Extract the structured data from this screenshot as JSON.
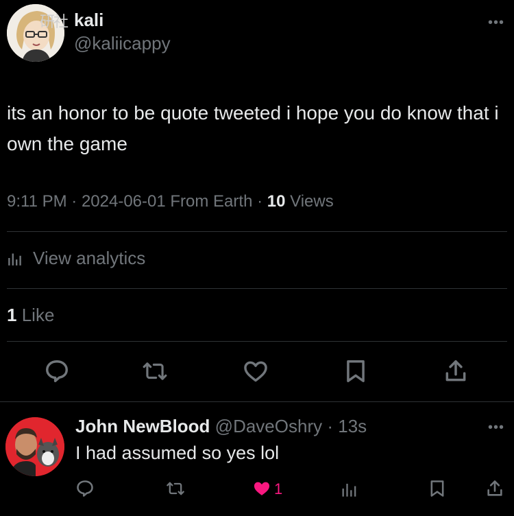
{
  "tweet": {
    "author_name": "kali",
    "author_handle": "@kaliicappy",
    "watermark": "研社",
    "text": "its an honor to be quote tweeted i hope you do know that i own the game",
    "time": "9:11 PM",
    "date": "2024-06-01",
    "source": "From Earth",
    "views_count": "10",
    "views_label": "Views",
    "analytics_label": "View analytics",
    "likes_count": "1",
    "likes_label": "Like",
    "more": "•••"
  },
  "reply": {
    "author_name": "John NewBlood",
    "author_handle": "@DaveOshry",
    "age": "13s",
    "text": "I had assumed so yes lol",
    "like_count": "1",
    "more": "•••"
  },
  "colors": {
    "background": "#000000",
    "text": "#e7e9ea",
    "secondary": "#71767b",
    "divider": "#2f3336",
    "like_active": "#f91880"
  }
}
